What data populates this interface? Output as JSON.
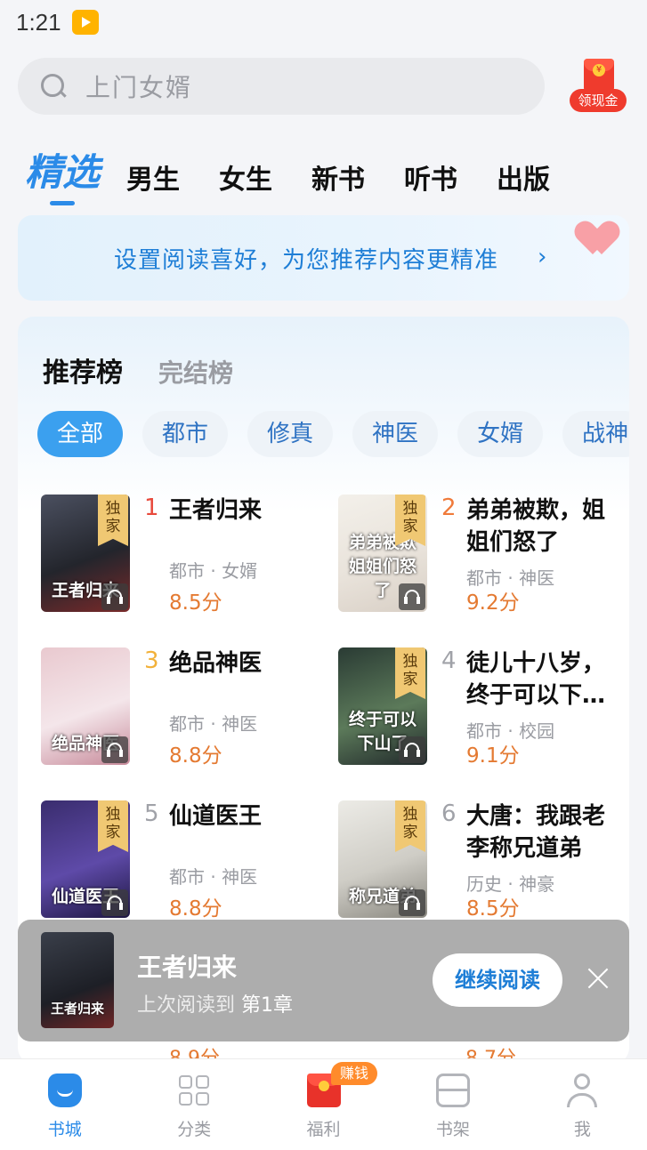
{
  "status_bar": {
    "time": "1:21",
    "app_icon": "tv-app-icon"
  },
  "search": {
    "placeholder": "上门女婿",
    "icon": "search-icon"
  },
  "cash_reward": {
    "label": "领现金",
    "icon": "red-envelope-icon"
  },
  "top_tabs": [
    {
      "label": "精选",
      "active": true
    },
    {
      "label": "男生"
    },
    {
      "label": "女生"
    },
    {
      "label": "新书"
    },
    {
      "label": "听书"
    },
    {
      "label": "出版"
    }
  ],
  "preference_banner": {
    "text": "设置阅读喜好，为您推荐内容更精准",
    "arrow": "›",
    "icon": "heart-icon"
  },
  "ranking": {
    "tabs": [
      {
        "label": "推荐榜",
        "active": true
      },
      {
        "label": "完结榜"
      }
    ],
    "chips": [
      "全部",
      "都市",
      "修真",
      "神医",
      "女婿",
      "战神"
    ],
    "exclusive_badge": "独\n家",
    "books": [
      {
        "rank": "1",
        "title": "王者归来",
        "meta": "都市 · 女婿",
        "score": "8.5分",
        "cover_text": "王者归来",
        "exclusive": true,
        "audio": true,
        "rank_color": "#e84a3c",
        "cover_colors": [
          "#4b5060",
          "#23252c",
          "#7a2a2a"
        ]
      },
      {
        "rank": "2",
        "title": "弟弟被欺，姐姐们怒了",
        "meta": "都市 · 神医",
        "score": "9.2分",
        "cover_text": "弟弟被欺 姐姐们怒了",
        "exclusive": true,
        "audio": true,
        "rank_color": "#f07a3a",
        "cover_colors": [
          "#f3f0ea",
          "#e9e3db",
          "#d8cfc5"
        ]
      },
      {
        "rank": "3",
        "title": "绝品神医",
        "meta": "都市 · 神医",
        "score": "8.8分",
        "cover_text": "绝品神医",
        "exclusive": false,
        "audio": true,
        "rank_color": "#f2b13a",
        "cover_colors": [
          "#e9c9cf",
          "#f4e6ea",
          "#c78a9a"
        ]
      },
      {
        "rank": "4",
        "title": "徒儿十八岁，终于可以下…",
        "meta": "都市 · 校园",
        "score": "9.1分",
        "cover_text": "终于可以下山了",
        "exclusive": true,
        "audio": true,
        "rank_color": "#a0a2a8",
        "cover_colors": [
          "#2a3b34",
          "#5c7a5a",
          "#20282a"
        ]
      },
      {
        "rank": "5",
        "title": "仙道医王",
        "meta": "都市 · 神医",
        "score": "8.8分",
        "cover_text": "仙道医王",
        "exclusive": true,
        "audio": true,
        "rank_color": "#a0a2a8",
        "cover_colors": [
          "#3a2d6e",
          "#5e4aa8",
          "#1d1640"
        ]
      },
      {
        "rank": "6",
        "title": "大唐：我跟老李称兄道弟",
        "meta": "历史 · 神豪",
        "score": "8.5分",
        "cover_text": "称兄道弟",
        "exclusive": true,
        "audio": true,
        "rank_color": "#a0a2a8",
        "cover_colors": [
          "#ecebe6",
          "#cfcdc6",
          "#8a8880"
        ]
      }
    ],
    "peek_scores": [
      "8.9分",
      "8.7分"
    ]
  },
  "continue_reading": {
    "title": "王者归来",
    "progress_prefix": "上次阅读到",
    "progress_chapter": "第1章",
    "cover_text": "王者归来",
    "button": "继续阅读",
    "close_icon": "close-icon"
  },
  "bottom_nav": {
    "earn_badge": "赚钱",
    "items": [
      {
        "label": "书城",
        "icon": "bookstore-icon",
        "active": true
      },
      {
        "label": "分类",
        "icon": "category-grid-icon"
      },
      {
        "label": "福利",
        "icon": "red-envelope-icon"
      },
      {
        "label": "书架",
        "icon": "bookshelf-icon"
      },
      {
        "label": "我",
        "icon": "profile-icon"
      }
    ]
  },
  "colors": {
    "accent": "#2b8be8",
    "score": "#e47a32",
    "exclusive_badge": "#f0c873"
  }
}
